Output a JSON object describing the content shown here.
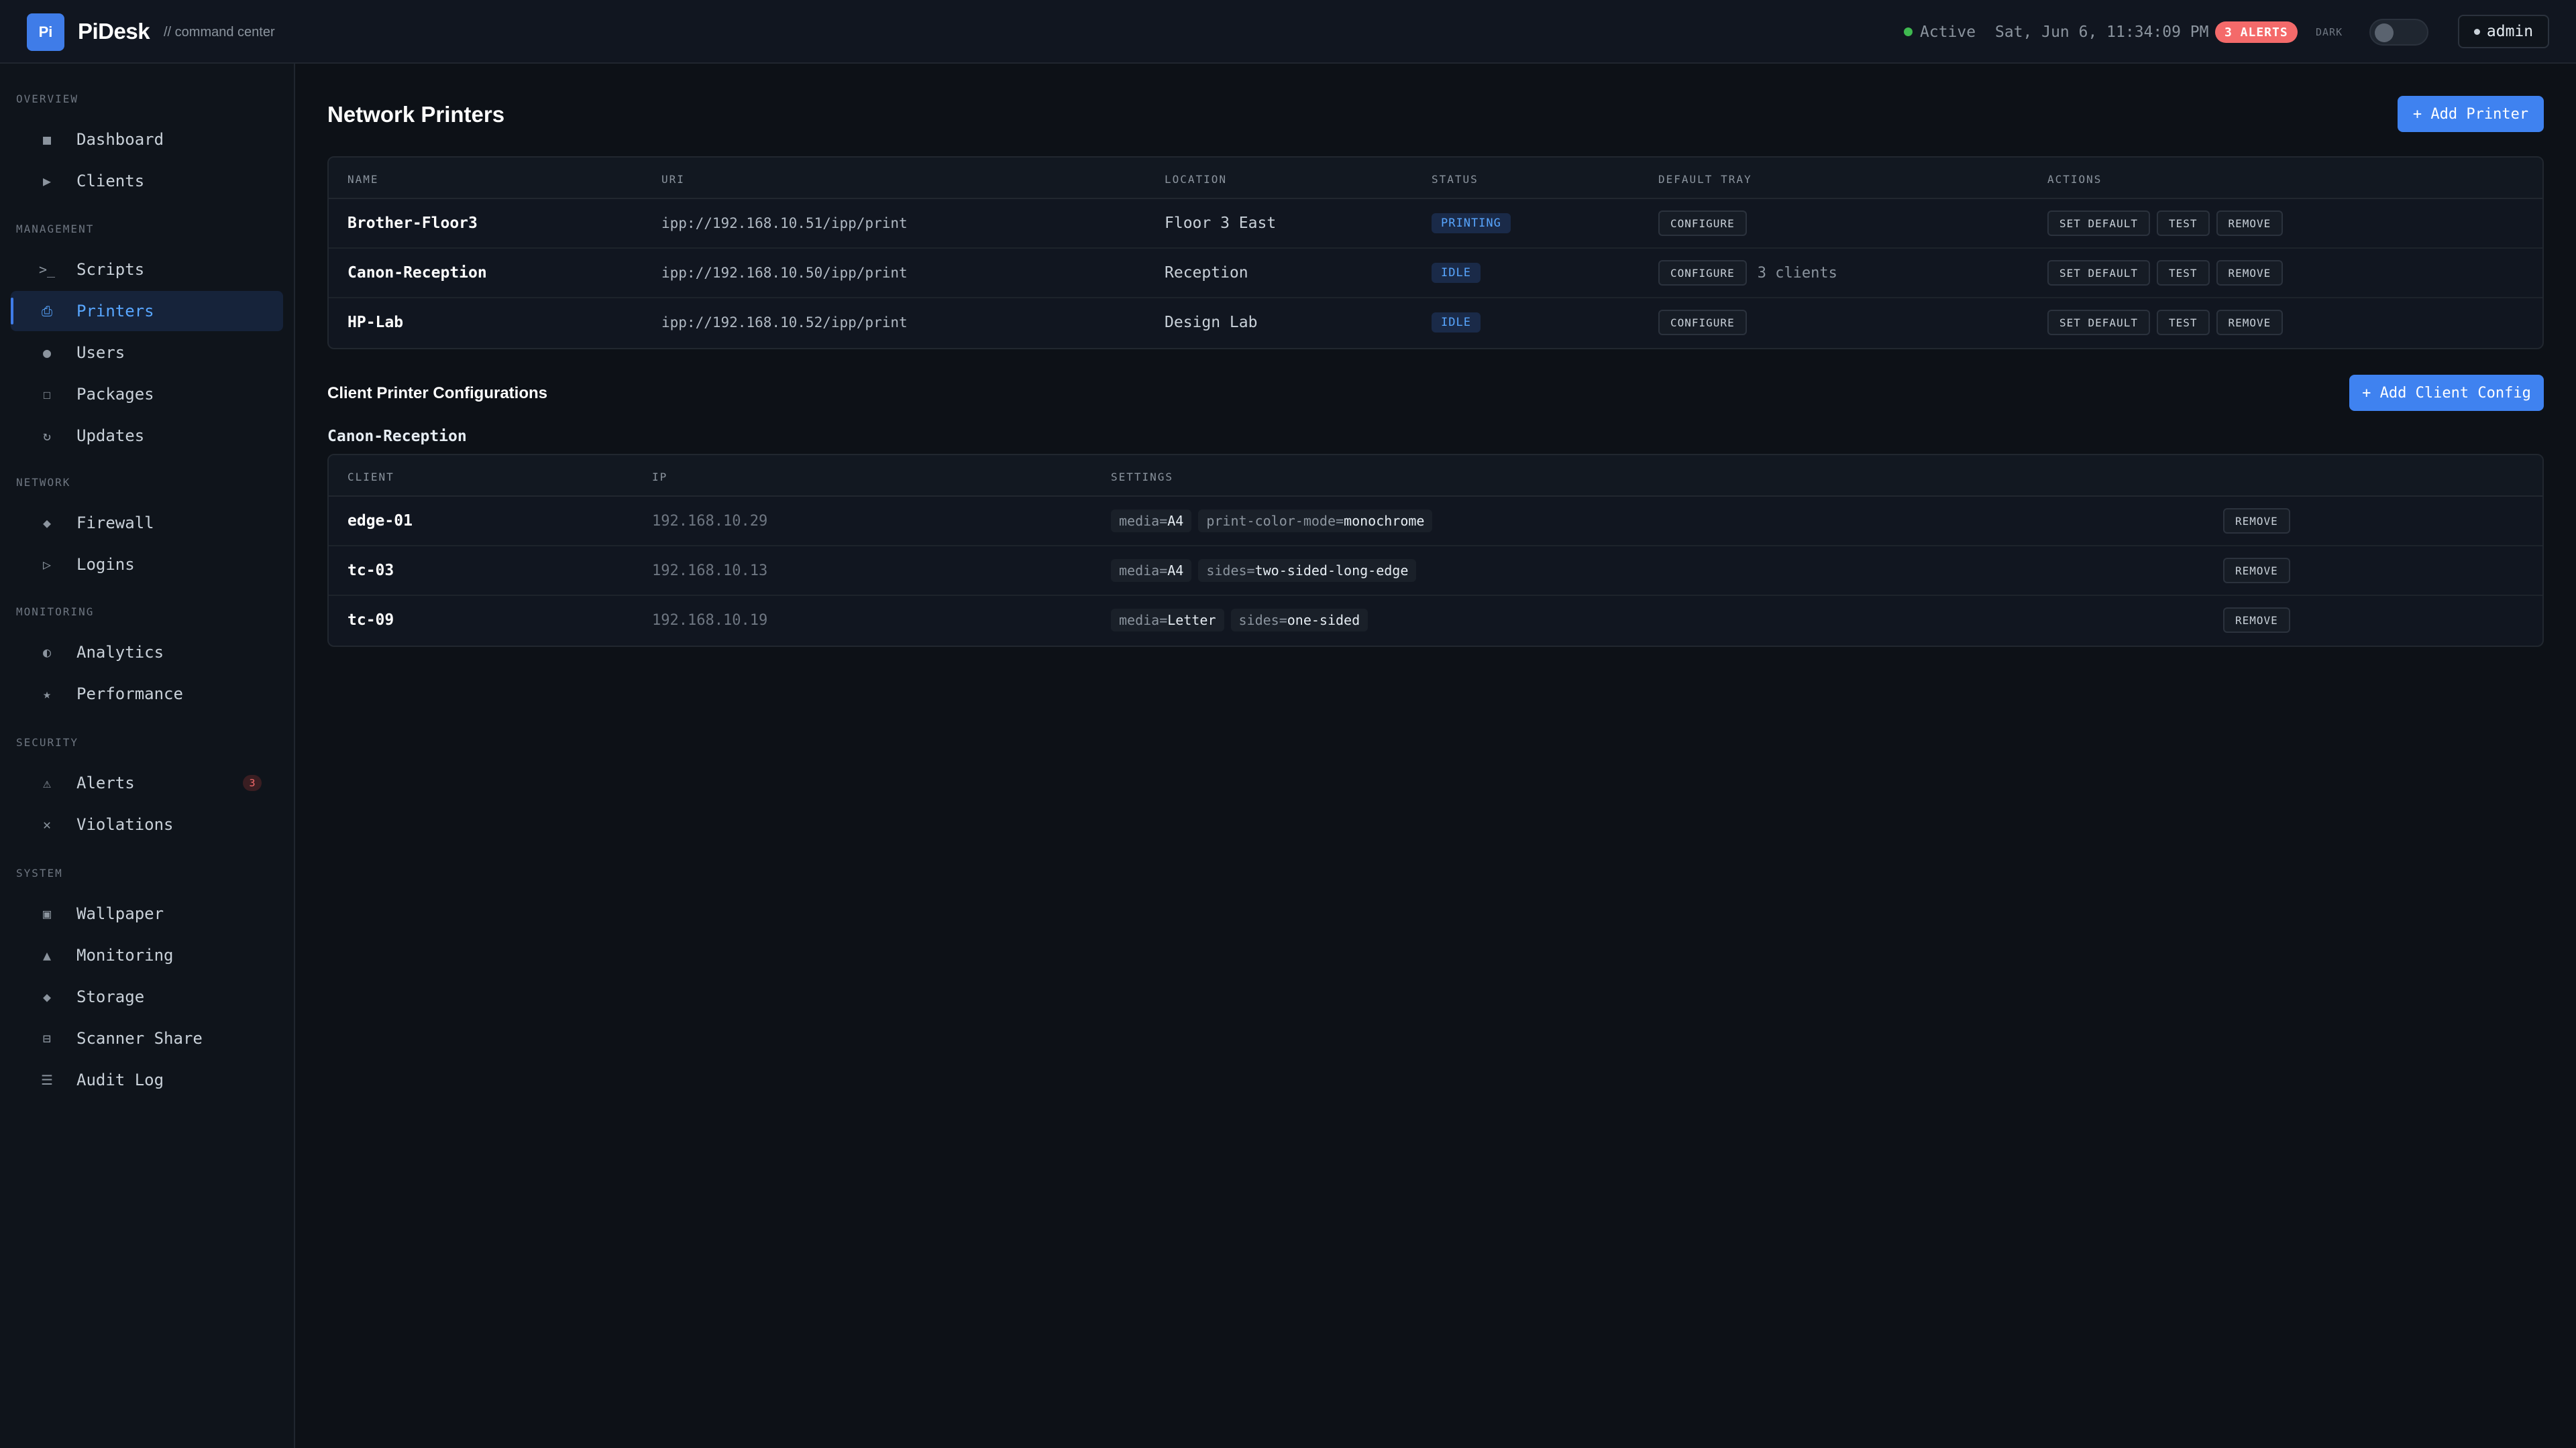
{
  "app": {
    "logo_text": "Pi",
    "name": "PiDesk",
    "subtitle": "// command center"
  },
  "header": {
    "status": "Active",
    "datetime": "Sat, Jun 6, 11:34:09 PM",
    "alerts_badge": "3 ALERTS",
    "theme_label": "DARK",
    "theme_dark_enabled": false,
    "user": "admin"
  },
  "sidebar": {
    "sections": [
      {
        "title": "OVERVIEW",
        "items": [
          {
            "label": "Dashboard",
            "icon": "■"
          },
          {
            "label": "Clients",
            "icon": "▶"
          }
        ]
      },
      {
        "title": "MANAGEMENT",
        "items": [
          {
            "label": "Scripts",
            "icon": ">_"
          },
          {
            "label": "Printers",
            "icon": "⎙",
            "active": true
          },
          {
            "label": "Users",
            "icon": "●"
          },
          {
            "label": "Packages",
            "icon": "☐"
          },
          {
            "label": "Updates",
            "icon": "↻"
          }
        ]
      },
      {
        "title": "NETWORK",
        "items": [
          {
            "label": "Firewall",
            "icon": "◆"
          },
          {
            "label": "Logins",
            "icon": "▷"
          }
        ]
      },
      {
        "title": "MONITORING",
        "items": [
          {
            "label": "Analytics",
            "icon": "◐"
          },
          {
            "label": "Performance",
            "icon": "★"
          }
        ]
      },
      {
        "title": "SECURITY",
        "items": [
          {
            "label": "Alerts",
            "icon": "⚠",
            "badge": "3"
          },
          {
            "label": "Violations",
            "icon": "✕"
          }
        ]
      },
      {
        "title": "SYSTEM",
        "items": [
          {
            "label": "Wallpaper",
            "icon": "▣"
          },
          {
            "label": "Monitoring",
            "icon": "▲"
          },
          {
            "label": "Storage",
            "icon": "◆"
          },
          {
            "label": "Scanner Share",
            "icon": "⊟"
          },
          {
            "label": "Audit Log",
            "icon": "☰"
          }
        ]
      }
    ]
  },
  "printers": {
    "title": "Network Printers",
    "add_button": "+ Add Printer",
    "columns": [
      "NAME",
      "URI",
      "LOCATION",
      "STATUS",
      "DEFAULT TRAY",
      "ACTIONS"
    ],
    "configure_label": "CONFIGURE",
    "set_default_label": "SET DEFAULT",
    "test_label": "TEST",
    "remove_label": "REMOVE",
    "rows": [
      {
        "name": "Brother-Floor3",
        "uri": "ipp://192.168.10.51/ipp/print",
        "location": "Floor 3 East",
        "status": "PRINTING",
        "tray_note": ""
      },
      {
        "name": "Canon-Reception",
        "uri": "ipp://192.168.10.50/ipp/print",
        "location": "Reception",
        "status": "IDLE",
        "tray_note": "3 clients"
      },
      {
        "name": "HP-Lab",
        "uri": "ipp://192.168.10.52/ipp/print",
        "location": "Design Lab",
        "status": "IDLE",
        "tray_note": ""
      }
    ]
  },
  "client_configs": {
    "title": "Client Printer Configurations",
    "add_button": "+ Add Client Config",
    "group": "Canon-Reception",
    "columns": [
      "CLIENT",
      "IP",
      "SETTINGS"
    ],
    "remove_label": "REMOVE",
    "rows": [
      {
        "client": "edge-01",
        "ip": "192.168.10.29",
        "settings": [
          {
            "key": "media=",
            "value": "A4"
          },
          {
            "key": "print-color-mode=",
            "value": "monochrome"
          }
        ]
      },
      {
        "client": "tc-03",
        "ip": "192.168.10.13",
        "settings": [
          {
            "key": "media=",
            "value": "A4"
          },
          {
            "key": "sides=",
            "value": "two-sided-long-edge"
          }
        ]
      },
      {
        "client": "tc-09",
        "ip": "192.168.10.19",
        "settings": [
          {
            "key": "media=",
            "value": "Letter"
          },
          {
            "key": "sides=",
            "value": "one-sided"
          }
        ]
      }
    ]
  },
  "colors": {
    "accent": "#3f82f0",
    "background": "#0d1117",
    "alert": "#f46a6a",
    "active_status": "#3fb950"
  }
}
